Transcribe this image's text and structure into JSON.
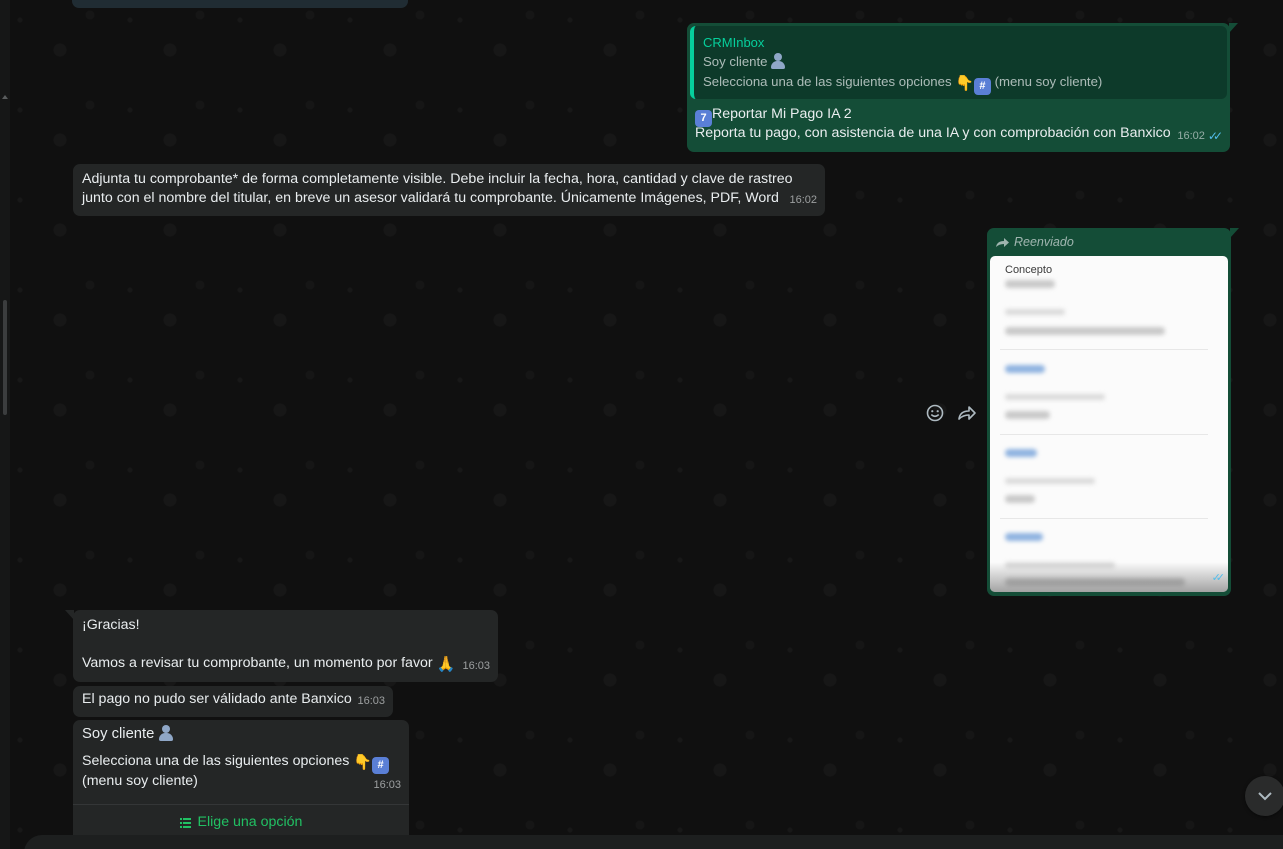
{
  "messages": {
    "m1": {
      "quote_author": "CRMInbox",
      "quote_line1": "Soy cliente",
      "quote_line2": "Selecciona una de las siguientes opciones",
      "quote_line2_suffix": "(menu soy cliente)",
      "title_number": "7",
      "title": "Reportar Mi Pago IA 2",
      "body": "Reporta tu pago, con asistencia de una IA y con comprobación con Banxico",
      "time": "16:02"
    },
    "m2": {
      "line1": "Adjunta tu comprobante* de forma completamente visible. Debe incluir la fecha, hora, cantidad y clave de rastreo",
      "line2": "junto con el nombre del titular, en breve un asesor validará tu comprobante. Únicamente Imágenes, PDF, Word",
      "time": "16:02"
    },
    "m3": {
      "forwarded_label": "Reenviado",
      "image_label": "Concepto"
    },
    "m4": {
      "line1": "¡Gracias!",
      "line2": "Vamos a revisar tu comprobante, un momento por favor",
      "time": "16:03"
    },
    "m5": {
      "text": "El pago no pudo ser válidado ante Banxico",
      "time": "16:03"
    },
    "m6": {
      "line1": "Soy cliente",
      "line2": "Selecciona una de las siguientes opciones",
      "line3": "(menu soy cliente)",
      "time": "16:03",
      "button": "Elige una opción"
    }
  },
  "icons": {
    "hash_keycap": "#",
    "pointing_down": "👇",
    "praying_hands": "🙏",
    "emoji_react": "emoji-icon",
    "forward": "forward-icon",
    "list": "list-icon",
    "scroll_down": "chevron-down-icon"
  },
  "colors": {
    "outgoing_bubble": "#144d37",
    "incoming_bubble": "#242626",
    "accent_green": "#06cf9c",
    "button_green": "#21c063",
    "read_ticks": "#53bdeb"
  }
}
